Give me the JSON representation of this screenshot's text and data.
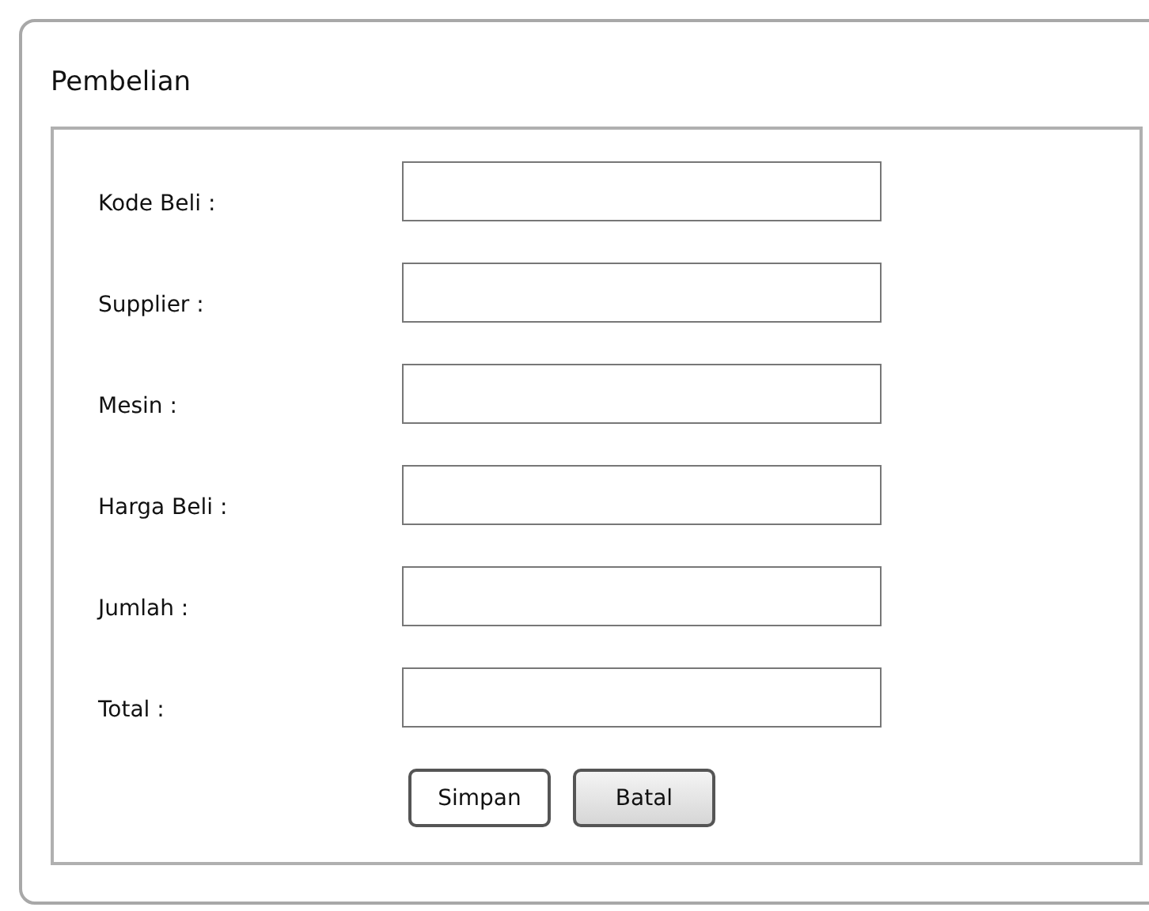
{
  "title": "Pembelian",
  "fields": [
    {
      "label": "Kode Beli :"
    },
    {
      "label": "Supplier :"
    },
    {
      "label": "Mesin :"
    },
    {
      "label": "Harga Beli :"
    },
    {
      "label": "Jumlah :"
    },
    {
      "label": "Total :"
    }
  ],
  "buttons": [
    {
      "label": "Simpan",
      "selected": true
    },
    {
      "label": "Batal",
      "selected": false
    }
  ]
}
